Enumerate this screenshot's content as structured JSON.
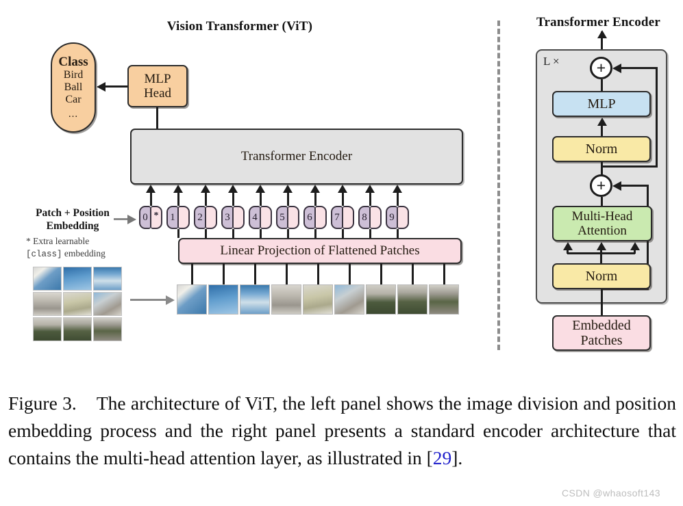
{
  "figure": {
    "left_panel_title": "Vision Transformer (ViT)",
    "right_panel_title": "Transformer Encoder"
  },
  "left_panel": {
    "class_box": {
      "heading": "Class",
      "items": [
        "Bird",
        "Ball",
        "Car"
      ],
      "ellipsis": "..."
    },
    "mlp_head": {
      "line1": "MLP",
      "line2": "Head"
    },
    "encoder_box": {
      "label": "Transformer Encoder"
    },
    "embedding_label": {
      "line1": "Patch + Position",
      "line2": "Embedding",
      "note_line1": "* Extra learnable",
      "note_code": "[class]",
      "note_line2_rest": " embedding"
    },
    "tokens": [
      {
        "index": "0",
        "star": "*"
      },
      {
        "index": "1",
        "star": ""
      },
      {
        "index": "2",
        "star": ""
      },
      {
        "index": "3",
        "star": ""
      },
      {
        "index": "4",
        "star": ""
      },
      {
        "index": "5",
        "star": ""
      },
      {
        "index": "6",
        "star": ""
      },
      {
        "index": "7",
        "star": ""
      },
      {
        "index": "8",
        "star": ""
      },
      {
        "index": "9",
        "star": ""
      }
    ],
    "linear_projection": {
      "label": "Linear Projection of Flattened Patches"
    },
    "patch_count": 9,
    "source_grid": {
      "rows": 3,
      "cols": 3
    }
  },
  "right_panel": {
    "repeat_label": "L ×",
    "blocks": {
      "mlp": "MLP",
      "norm_top": "Norm",
      "attention_line1": "Multi-Head",
      "attention_line2": "Attention",
      "norm_bottom": "Norm",
      "embedded_patches_line1": "Embedded",
      "embedded_patches_line2": "Patches"
    },
    "residual_symbol": "+"
  },
  "caption": {
    "prefix": "Figure 3.",
    "body_before_ref": "The architecture of ViT, the left panel shows the image division and position embedding process and the right panel presents a standard encoder architecture that contains the multi-head attention layer, as illustrated in [",
    "reference": "29",
    "body_after_ref": "]."
  },
  "watermark": {
    "text": "CSDN @whaosoft143"
  },
  "colors": {
    "orange": "#f8cfa0",
    "pink": "#fadde3",
    "grey": "#e2e2e2",
    "blue": "#c7e1f2",
    "yellow": "#f9e9a6",
    "green": "#caeab0",
    "position_embed": "#cdbfd6",
    "patch_embed": "#fae2e6",
    "reference_link": "#2222cc",
    "stroke": "#1d1d1d"
  }
}
